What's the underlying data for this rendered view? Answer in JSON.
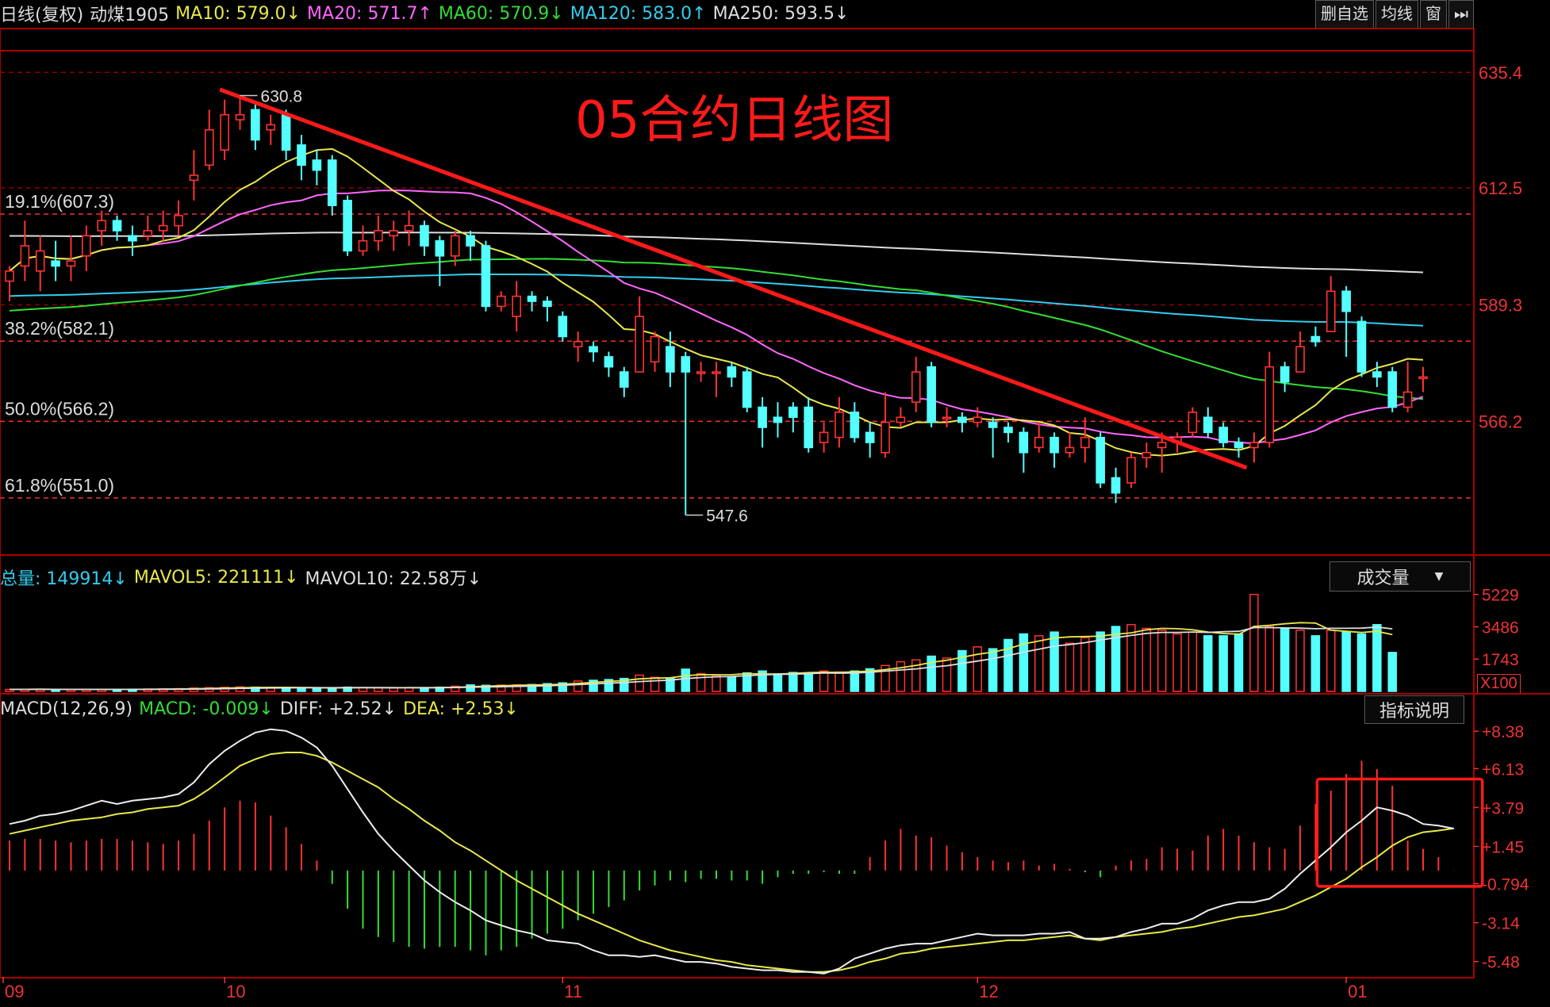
{
  "header": {
    "items": [
      {
        "text": "日线(复权)",
        "color": "#dddddd"
      },
      {
        "text": "动煤1905",
        "color": "#dddddd"
      },
      {
        "text": "MA10: 579.0↓",
        "color": "#e8e84a"
      },
      {
        "text": "MA20: 571.7↑",
        "color": "#ff66ff"
      },
      {
        "text": "MA60: 570.9↓",
        "color": "#33dd33"
      },
      {
        "text": "MA120: 583.0↑",
        "color": "#33ccee"
      },
      {
        "text": "MA250: 593.5↓",
        "color": "#dddddd"
      }
    ],
    "buttons": [
      "删自选",
      "均线",
      "窗",
      "⏭"
    ]
  },
  "chart_title": "05合约日线图",
  "price_axis": [
    "635.4",
    "612.5",
    "589.3",
    "566.2"
  ],
  "fib_levels": [
    {
      "label": "19.1%(607.3)",
      "value": 607.3
    },
    {
      "label": "38.2%(582.1)",
      "value": 582.1
    },
    {
      "label": "50.0%(566.2)",
      "value": 566.2
    },
    {
      "label": "61.8%(551.0)",
      "value": 551.0
    }
  ],
  "high_label": "630.8",
  "low_label": "547.6",
  "volume_header": {
    "items": [
      {
        "text": "总量: 149914↓",
        "color": "#33ccee"
      },
      {
        "text": "MAVOL5: 221111↓",
        "color": "#e8e84a"
      },
      {
        "text": "MAVOL10: 22.58万↓",
        "color": "#dddddd"
      }
    ],
    "dropdown": "成交量"
  },
  "volume_axis": [
    "5229",
    "3486",
    "1743"
  ],
  "volume_unit": "X100",
  "macd_header": {
    "items": [
      {
        "text": "MACD(12,26,9)",
        "color": "#dddddd"
      },
      {
        "text": "MACD: -0.009↓",
        "color": "#33dd33"
      },
      {
        "text": "DIFF: +2.52↓",
        "color": "#dddddd"
      },
      {
        "text": "DEA: +2.53↓",
        "color": "#e8e84a"
      }
    ],
    "button": "指标说明"
  },
  "macd_axis": [
    "+8.38",
    "+6.13",
    "+3.79",
    "+1.45",
    "-0.794",
    "-3.14",
    "-5.48"
  ],
  "x_axis": [
    "09",
    "10",
    "11",
    "12",
    "01"
  ],
  "colors": {
    "up": "#ff3232",
    "down": "#54ffff",
    "grid": "#8b0000",
    "frame": "#aa0000",
    "bg": "#000000"
  },
  "chart_data": {
    "type": "candlestick",
    "symbol": "动煤1905",
    "period": "日线(复权)",
    "y_range_price": [
      540,
      640
    ],
    "y_range_volume": [
      0,
      5229
    ],
    "y_range_macd": [
      -6.2,
      9.2
    ],
    "candles": [
      {
        "o": 594,
        "c": 596,
        "h": 597,
        "l": 590
      },
      {
        "o": 597,
        "c": 601,
        "h": 606,
        "l": 594
      },
      {
        "o": 596,
        "c": 600,
        "h": 603,
        "l": 592
      },
      {
        "o": 598,
        "c": 597,
        "h": 602,
        "l": 594
      },
      {
        "o": 597,
        "c": 598,
        "h": 603,
        "l": 594
      },
      {
        "o": 599,
        "c": 603,
        "h": 605,
        "l": 596
      },
      {
        "o": 604,
        "c": 606,
        "h": 608,
        "l": 601
      },
      {
        "o": 606,
        "c": 604,
        "h": 607,
        "l": 602
      },
      {
        "o": 603,
        "c": 602,
        "h": 605,
        "l": 599
      },
      {
        "o": 603,
        "c": 604,
        "h": 607,
        "l": 602
      },
      {
        "o": 604,
        "c": 605,
        "h": 608,
        "l": 602
      },
      {
        "o": 605,
        "c": 607,
        "h": 610,
        "l": 603
      },
      {
        "o": 614,
        "c": 615,
        "h": 620,
        "l": 610
      },
      {
        "o": 617,
        "c": 624,
        "h": 628,
        "l": 616
      },
      {
        "o": 620,
        "c": 627,
        "h": 630,
        "l": 618
      },
      {
        "o": 626,
        "c": 627,
        "h": 630.8,
        "l": 624
      },
      {
        "o": 628,
        "c": 622,
        "h": 629,
        "l": 620
      },
      {
        "o": 624,
        "c": 625,
        "h": 627,
        "l": 621
      },
      {
        "o": 627,
        "c": 620,
        "h": 628,
        "l": 618
      },
      {
        "o": 621,
        "c": 617,
        "h": 623,
        "l": 614
      },
      {
        "o": 618,
        "c": 616,
        "h": 620,
        "l": 613
      },
      {
        "o": 618,
        "c": 609,
        "h": 619,
        "l": 607
      },
      {
        "o": 610,
        "c": 600,
        "h": 611,
        "l": 599
      },
      {
        "o": 600,
        "c": 602,
        "h": 605,
        "l": 599
      },
      {
        "o": 602,
        "c": 604,
        "h": 607,
        "l": 600
      },
      {
        "o": 603,
        "c": 604,
        "h": 606,
        "l": 600
      },
      {
        "o": 604,
        "c": 605,
        "h": 608,
        "l": 601
      },
      {
        "o": 605,
        "c": 601,
        "h": 606,
        "l": 599
      },
      {
        "o": 602,
        "c": 599,
        "h": 603,
        "l": 593
      },
      {
        "o": 599,
        "c": 603,
        "h": 604,
        "l": 597
      },
      {
        "o": 603,
        "c": 601,
        "h": 604,
        "l": 598
      },
      {
        "o": 601,
        "c": 589,
        "h": 602,
        "l": 588
      },
      {
        "o": 589,
        "c": 591,
        "h": 592,
        "l": 588
      },
      {
        "o": 587,
        "c": 591,
        "h": 594,
        "l": 584
      },
      {
        "o": 591,
        "c": 590,
        "h": 592,
        "l": 588
      },
      {
        "o": 590,
        "c": 589,
        "h": 591,
        "l": 586
      },
      {
        "o": 587,
        "c": 583,
        "h": 588,
        "l": 582
      },
      {
        "o": 581,
        "c": 582,
        "h": 584,
        "l": 578
      },
      {
        "o": 581,
        "c": 580,
        "h": 582,
        "l": 578
      },
      {
        "o": 579,
        "c": 577,
        "h": 580,
        "l": 575
      },
      {
        "o": 576,
        "c": 573,
        "h": 577,
        "l": 571
      },
      {
        "o": 576,
        "c": 587,
        "h": 591,
        "l": 576
      },
      {
        "o": 578,
        "c": 583,
        "h": 584,
        "l": 576
      },
      {
        "o": 581,
        "c": 576,
        "h": 584,
        "l": 573
      },
      {
        "o": 579,
        "c": 576,
        "h": 580,
        "l": 547.6
      },
      {
        "o": 576,
        "c": 576,
        "h": 578,
        "l": 574
      },
      {
        "o": 576,
        "c": 576,
        "h": 578,
        "l": 571
      },
      {
        "o": 577,
        "c": 575,
        "h": 578,
        "l": 573
      },
      {
        "o": 576,
        "c": 569,
        "h": 577,
        "l": 568
      },
      {
        "o": 569,
        "c": 565,
        "h": 571,
        "l": 561
      },
      {
        "o": 567,
        "c": 566,
        "h": 570,
        "l": 563
      },
      {
        "o": 569,
        "c": 567,
        "h": 570,
        "l": 564
      },
      {
        "o": 569,
        "c": 561,
        "h": 571,
        "l": 560
      },
      {
        "o": 562,
        "c": 564,
        "h": 566,
        "l": 560
      },
      {
        "o": 563,
        "c": 568,
        "h": 571,
        "l": 561
      },
      {
        "o": 568,
        "c": 563,
        "h": 570,
        "l": 562
      },
      {
        "o": 564,
        "c": 562,
        "h": 566,
        "l": 559
      },
      {
        "o": 560,
        "c": 566,
        "h": 572,
        "l": 559
      },
      {
        "o": 566,
        "c": 567,
        "h": 569,
        "l": 565
      },
      {
        "o": 570,
        "c": 576,
        "h": 579,
        "l": 568
      },
      {
        "o": 577,
        "c": 566,
        "h": 578,
        "l": 565
      },
      {
        "o": 567,
        "c": 567,
        "h": 569,
        "l": 565
      },
      {
        "o": 567,
        "c": 566,
        "h": 568,
        "l": 564
      },
      {
        "o": 566,
        "c": 567,
        "h": 569,
        "l": 565
      },
      {
        "o": 566,
        "c": 565,
        "h": 567,
        "l": 559
      },
      {
        "o": 565,
        "c": 564,
        "h": 566,
        "l": 562
      },
      {
        "o": 564,
        "c": 560,
        "h": 565,
        "l": 556
      },
      {
        "o": 561,
        "c": 563,
        "h": 566,
        "l": 560
      },
      {
        "o": 563,
        "c": 560,
        "h": 564,
        "l": 557
      },
      {
        "o": 560,
        "c": 561,
        "h": 564,
        "l": 559
      },
      {
        "o": 561,
        "c": 563,
        "h": 567,
        "l": 558
      },
      {
        "o": 563,
        "c": 554,
        "h": 564,
        "l": 553
      },
      {
        "o": 555,
        "c": 552,
        "h": 557,
        "l": 550
      },
      {
        "o": 554,
        "c": 559,
        "h": 560,
        "l": 553
      },
      {
        "o": 559,
        "c": 560,
        "h": 562,
        "l": 557
      },
      {
        "o": 561,
        "c": 562,
        "h": 564,
        "l": 556
      },
      {
        "o": 562,
        "c": 563,
        "h": 564,
        "l": 560
      },
      {
        "o": 564,
        "c": 568,
        "h": 569,
        "l": 563
      },
      {
        "o": 567,
        "c": 564,
        "h": 569,
        "l": 563
      },
      {
        "o": 565,
        "c": 562,
        "h": 566,
        "l": 561
      },
      {
        "o": 562,
        "c": 561,
        "h": 563,
        "l": 559
      },
      {
        "o": 561,
        "c": 562,
        "h": 564,
        "l": 558
      },
      {
        "o": 562,
        "c": 577,
        "h": 580,
        "l": 561
      },
      {
        "o": 577,
        "c": 574,
        "h": 578,
        "l": 572
      },
      {
        "o": 576,
        "c": 581,
        "h": 584,
        "l": 576
      },
      {
        "o": 583,
        "c": 582,
        "h": 585,
        "l": 581
      },
      {
        "o": 584,
        "c": 592,
        "h": 595,
        "l": 584
      },
      {
        "o": 592,
        "c": 588,
        "h": 593,
        "l": 579
      },
      {
        "o": 586,
        "c": 576,
        "h": 587,
        "l": 575
      },
      {
        "o": 576,
        "c": 575,
        "h": 578,
        "l": 573
      },
      {
        "o": 576,
        "c": 569,
        "h": 577,
        "l": 568
      },
      {
        "o": 569,
        "c": 572,
        "h": 578,
        "l": 568
      },
      {
        "o": 575,
        "c": 575,
        "h": 577,
        "l": 572
      }
    ],
    "volume": [
      110,
      110,
      120,
      110,
      100,
      105,
      110,
      115,
      120,
      130,
      140,
      150,
      180,
      200,
      220,
      240,
      230,
      210,
      200,
      190,
      180,
      170,
      230,
      210,
      200,
      190,
      200,
      210,
      230,
      280,
      350,
      330,
      340,
      350,
      370,
      420,
      460,
      560,
      600,
      640,
      700,
      880,
      760,
      700,
      1200,
      960,
      860,
      780,
      1000,
      1100,
      950,
      1020,
      1000,
      1100,
      1050,
      1100,
      1220,
      1400,
      1600,
      1700,
      1900,
      1800,
      2200,
      2400,
      2300,
      2800,
      3100,
      3000,
      3200,
      2600,
      2900,
      3200,
      3500,
      3600,
      3400,
      3300,
      3100,
      3200,
      3000,
      3000,
      3100,
      5229,
      3500,
      3400,
      3300,
      3000,
      3300,
      3200,
      3100,
      3600,
      2100
    ],
    "macd_hist": [
      1.8,
      1.9,
      1.9,
      1.8,
      1.7,
      1.8,
      1.9,
      1.9,
      1.8,
      1.7,
      1.6,
      1.8,
      2.2,
      3.0,
      3.8,
      4.2,
      4.1,
      3.3,
      2.6,
      1.6,
      0.6,
      -0.8,
      -2.3,
      -3.5,
      -4.0,
      -4.3,
      -4.6,
      -4.7,
      -4.6,
      -4.6,
      -4.8,
      -5.1,
      -4.8,
      -4.6,
      -4.1,
      -3.8,
      -3.5,
      -3.0,
      -2.6,
      -2.2,
      -1.8,
      -1.2,
      -0.9,
      -0.6,
      -0.7,
      -0.5,
      -0.5,
      -0.6,
      -0.6,
      -0.8,
      -0.4,
      -0.2,
      -0.2,
      -0.1,
      -0.2,
      -0.2,
      0.8,
      1.8,
      2.5,
      2.1,
      2.0,
      1.5,
      1.1,
      0.8,
      0.6,
      0.5,
      0.6,
      0.3,
      0.4,
      0.1,
      -0.1,
      -0.4,
      0.3,
      0.6,
      0.7,
      1.4,
      1.3,
      1.2,
      2.1,
      2.5,
      2.1,
      1.7,
      1.4,
      1.3,
      2.7,
      4.0,
      4.8,
      5.8,
      6.6,
      6.1,
      5.1,
      1.8,
      1.3,
      0.8,
      -0.009
    ],
    "diff": [
      2.8,
      3.0,
      3.3,
      3.4,
      3.6,
      3.9,
      4.2,
      4.0,
      4.2,
      4.3,
      4.4,
      4.6,
      5.3,
      6.4,
      7.2,
      7.8,
      8.3,
      8.5,
      8.4,
      8.0,
      7.4,
      6.3,
      4.9,
      3.5,
      2.2,
      1.2,
      0.3,
      -0.6,
      -1.3,
      -1.9,
      -2.4,
      -3.0,
      -3.3,
      -3.6,
      -3.8,
      -4.2,
      -4.3,
      -4.4,
      -4.8,
      -5.1,
      -5.1,
      -5.2,
      -5.1,
      -5.3,
      -5.5,
      -5.5,
      -5.6,
      -5.8,
      -5.9,
      -6.0,
      -6.0,
      -6.1,
      -6.1,
      -6.2,
      -5.9,
      -5.3,
      -5.0,
      -4.7,
      -4.5,
      -4.4,
      -4.4,
      -4.2,
      -4.0,
      -3.8,
      -3.9,
      -3.9,
      -3.9,
      -3.8,
      -3.8,
      -3.7,
      -4.1,
      -4.1,
      -4.0,
      -3.7,
      -3.5,
      -3.2,
      -3.2,
      -2.9,
      -2.4,
      -2.1,
      -1.9,
      -1.9,
      -1.7,
      -1.1,
      -0.2,
      0.6,
      1.4,
      2.3,
      3.0,
      3.8,
      3.6,
      3.3,
      2.8,
      2.7,
      2.52
    ],
    "dea": [
      2.2,
      2.4,
      2.6,
      2.8,
      3.0,
      3.1,
      3.2,
      3.4,
      3.5,
      3.7,
      3.8,
      3.9,
      4.3,
      4.9,
      5.6,
      6.3,
      6.7,
      7.0,
      7.1,
      7.1,
      6.9,
      6.5,
      6.0,
      5.5,
      5.0,
      4.3,
      3.7,
      3.0,
      2.4,
      1.7,
      1.2,
      0.6,
      0.0,
      -0.6,
      -1.1,
      -1.6,
      -2.1,
      -2.6,
      -3.0,
      -3.4,
      -3.8,
      -4.2,
      -4.5,
      -4.8,
      -5.0,
      -5.2,
      -5.4,
      -5.5,
      -5.7,
      -5.8,
      -5.9,
      -6.0,
      -6.1,
      -6.1,
      -6.0,
      -5.8,
      -5.5,
      -5.3,
      -5.0,
      -4.9,
      -4.7,
      -4.6,
      -4.5,
      -4.4,
      -4.3,
      -4.2,
      -4.2,
      -4.1,
      -4.0,
      -3.9,
      -4.1,
      -4.2,
      -4.0,
      -3.9,
      -3.8,
      -3.7,
      -3.5,
      -3.4,
      -3.2,
      -3.0,
      -2.8,
      -2.7,
      -2.5,
      -2.3,
      -1.9,
      -1.5,
      -1.0,
      -0.5,
      0.2,
      0.8,
      1.5,
      2.0,
      2.3,
      2.4,
      2.53
    ],
    "ma10_last": 579.0,
    "ma20_last": 571.7,
    "ma60_last": 570.9,
    "ma120_last": 583.0,
    "ma250_last": 593.5
  }
}
